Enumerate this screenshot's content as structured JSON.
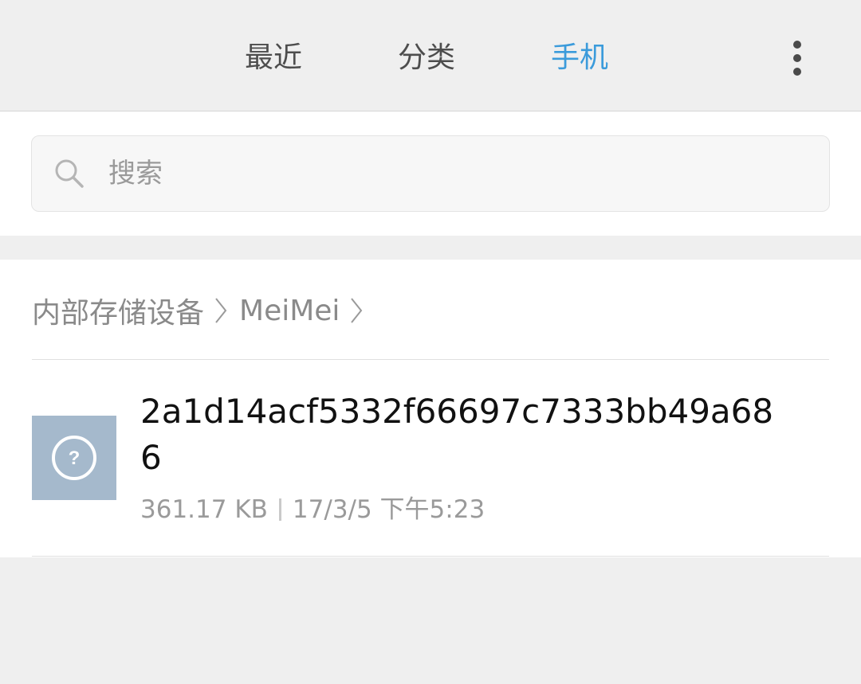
{
  "tabs": {
    "recent": "最近",
    "category": "分类",
    "phone": "手机",
    "active": "phone",
    "active_color": "#3b9bdb"
  },
  "more_icon": "more-vertical-icon",
  "search": {
    "placeholder": "搜索",
    "icon": "search-icon"
  },
  "breadcrumb": {
    "items": [
      "内部存储设备",
      "MeiMei"
    ],
    "separator_icon": "chevron-right-icon"
  },
  "files": [
    {
      "name": "2a1d14acf5332f66697c7333bb49a686",
      "size": "361.17 KB",
      "date": "17/3/5 下午5:23",
      "icon": "unknown-file-question-icon"
    }
  ]
}
